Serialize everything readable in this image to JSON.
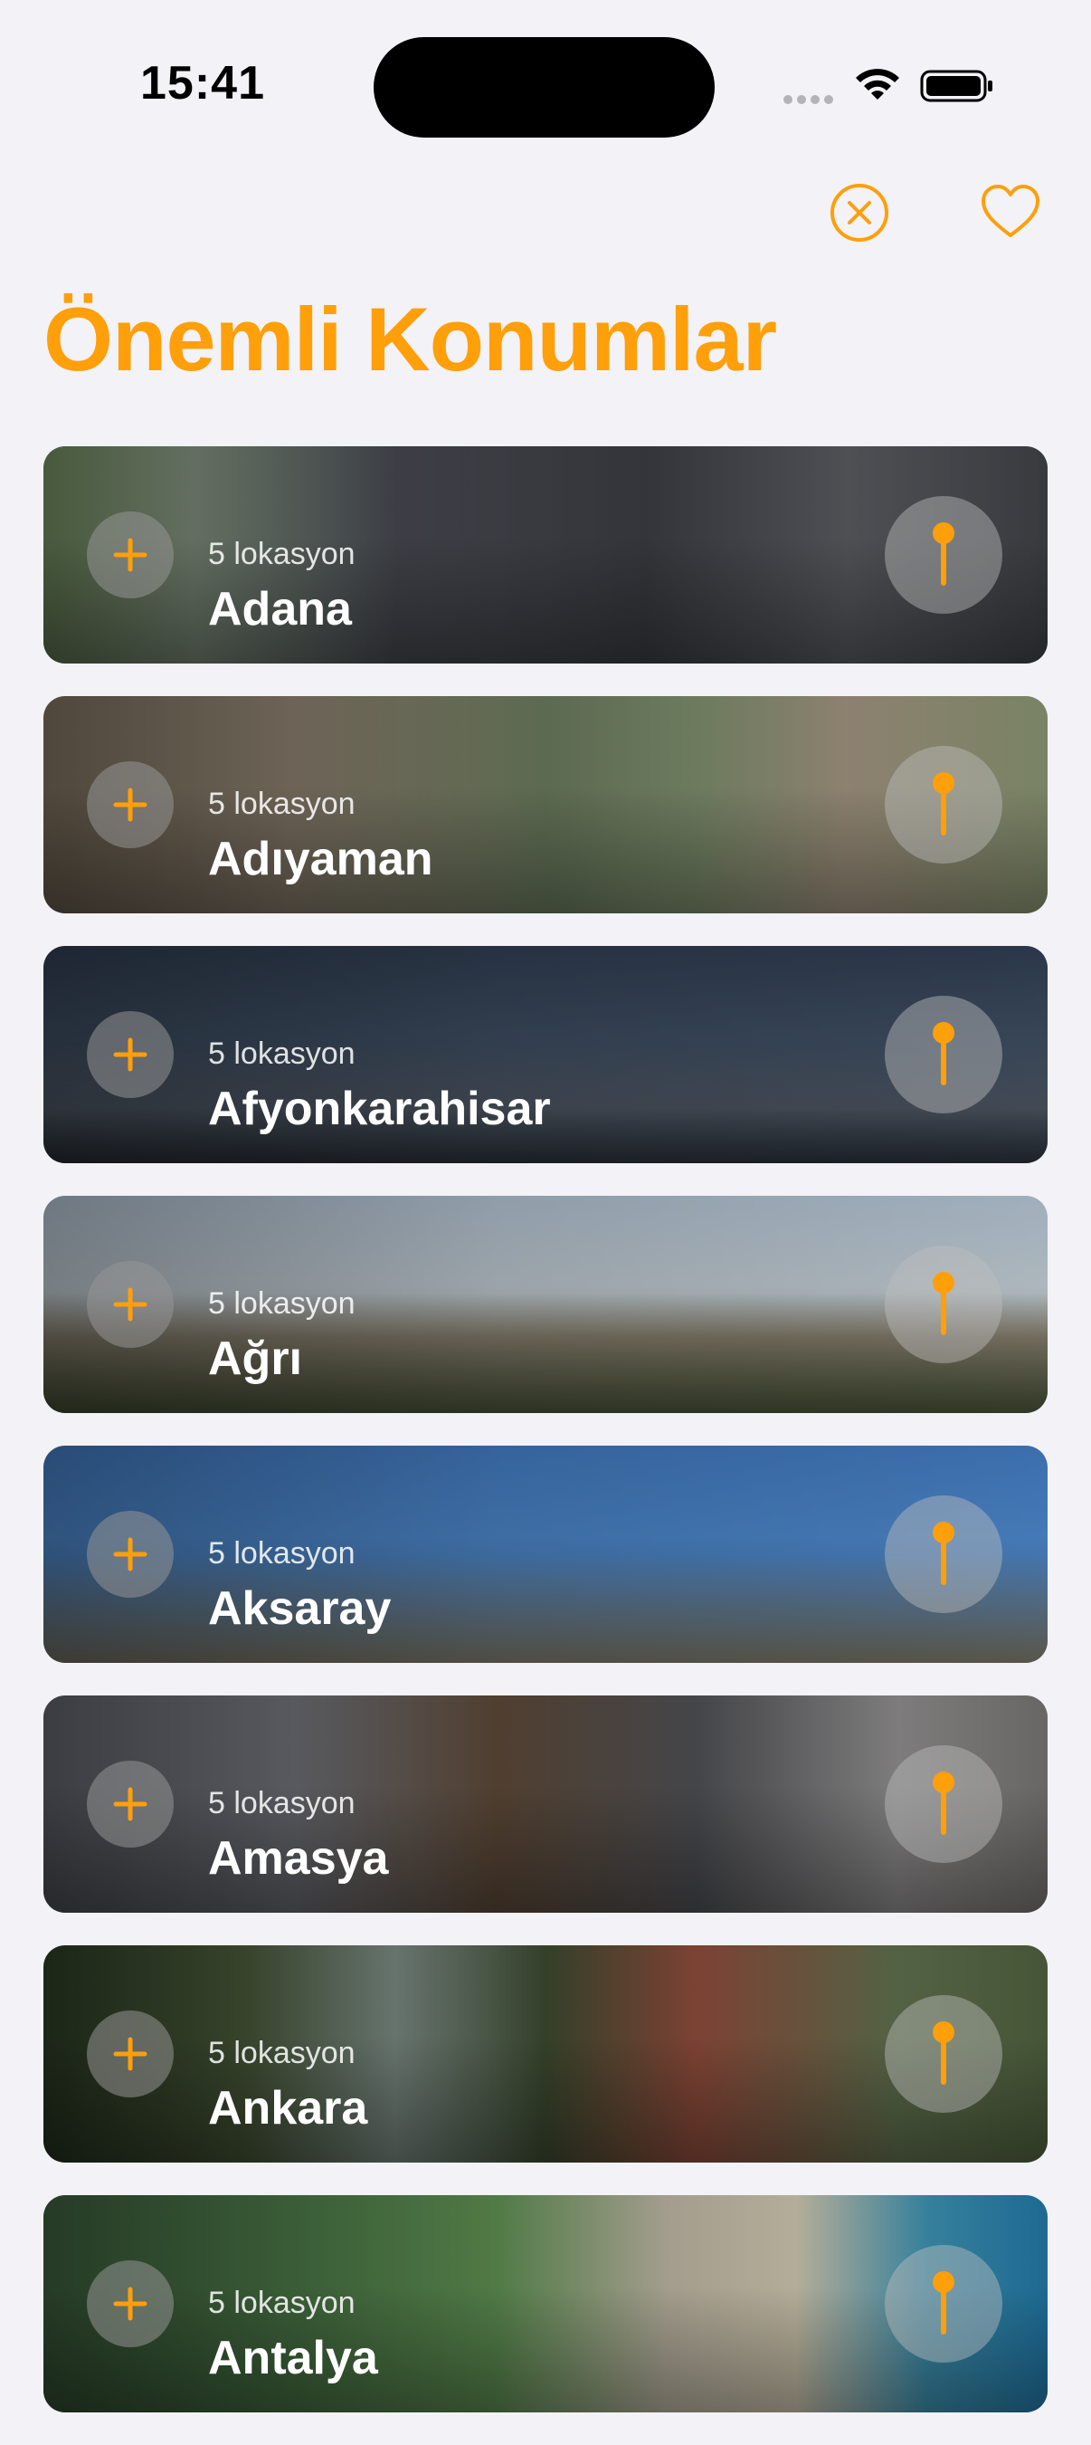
{
  "status_bar": {
    "time": "15:41"
  },
  "header": {
    "title": "Önemli Konumlar",
    "close_icon": "xmark-circle-icon",
    "favorite_icon": "heart-icon",
    "accent_color": "#FF9F0A"
  },
  "cities": [
    {
      "count": "5 lokasyon",
      "name": "Adana"
    },
    {
      "count": "5 lokasyon",
      "name": "Adıyaman"
    },
    {
      "count": "5 lokasyon",
      "name": "Afyonkarahisar"
    },
    {
      "count": "5 lokasyon",
      "name": "Ağrı"
    },
    {
      "count": "5 lokasyon",
      "name": "Aksaray"
    },
    {
      "count": "5 lokasyon",
      "name": "Amasya"
    },
    {
      "count": "5 lokasyon",
      "name": "Ankara"
    },
    {
      "count": "5 lokasyon",
      "name": "Antalya"
    }
  ]
}
